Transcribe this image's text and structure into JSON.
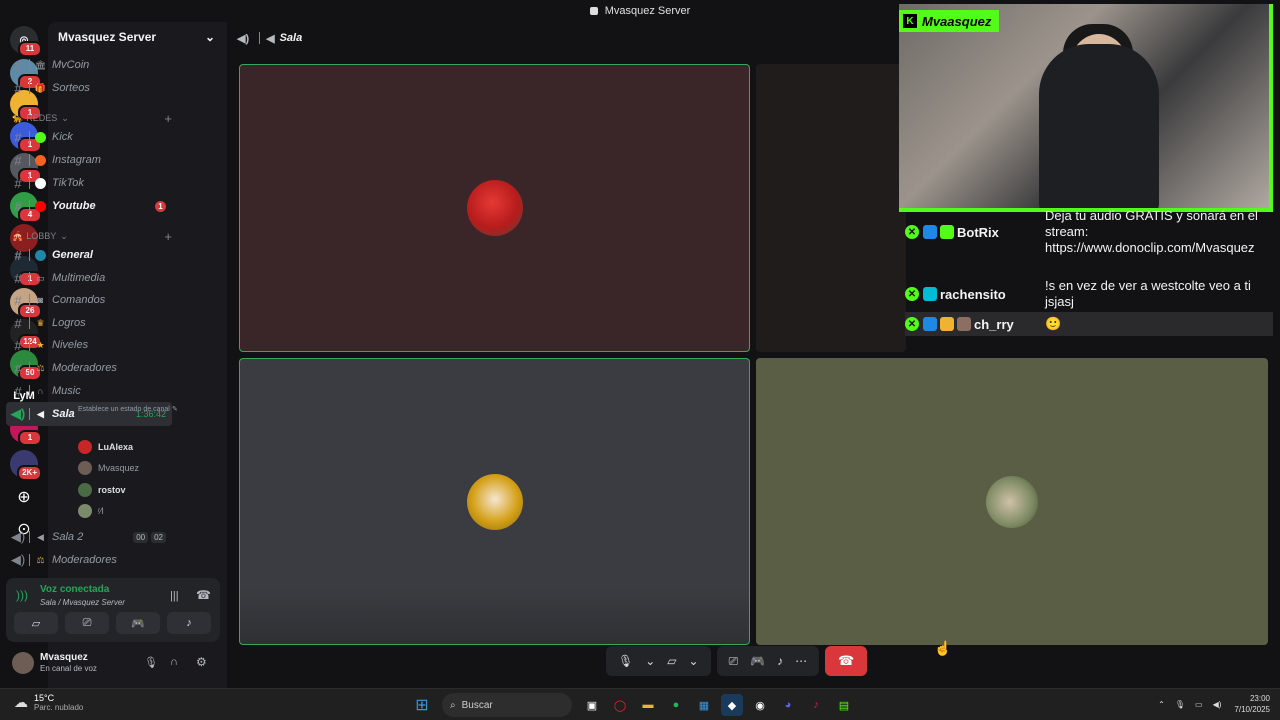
{
  "window": {
    "title": "Mvasquez Server"
  },
  "server_rail": {
    "badges": [
      "11",
      "2",
      "1",
      "1",
      "1",
      "1",
      "4",
      "1",
      "1",
      "26",
      "124",
      "50",
      "1",
      "2K+"
    ],
    "text_server": "LyM"
  },
  "sidebar": {
    "server_name": "Mvasquez Server",
    "channels_top": [
      {
        "label": "MvCoin",
        "icon": "bank-icon"
      },
      {
        "label": "Sorteos",
        "icon": "gift-icon"
      }
    ],
    "category_redes": "REDES",
    "channels_redes": [
      {
        "label": "Kick",
        "color": "#53fc18"
      },
      {
        "label": "Instagram",
        "color": "#f26322"
      },
      {
        "label": "TikTok",
        "color": "#ffffff"
      },
      {
        "label": "Youtube",
        "color": "#ff0000",
        "badge": "1"
      }
    ],
    "category_lobby": "LOBBY",
    "channels_lobby": [
      {
        "label": "General",
        "icon": "globe-icon"
      },
      {
        "label": "Multimedia",
        "icon": "image-icon"
      },
      {
        "label": "Comandos",
        "icon": "robot-icon"
      },
      {
        "label": "Logros",
        "icon": "trophy-icon"
      },
      {
        "label": "Niveles",
        "icon": "star-icon"
      },
      {
        "label": "Moderadores",
        "icon": "scale-icon"
      },
      {
        "label": "Music",
        "icon": "headphones-icon"
      }
    ],
    "active_voice": {
      "label": "Sala",
      "time": "1:36:42",
      "status": "Establece un estado de canal"
    },
    "voice_users": [
      "LuAlexa",
      "Mvasquez",
      "rostov",
      "ʳ⁄l"
    ],
    "voice_channels": [
      {
        "label": "Sala 2",
        "count_a": "00",
        "count_b": "02"
      },
      {
        "label": "Moderadores"
      }
    ]
  },
  "voice_panel": {
    "connected": "Voz conectada",
    "location": "Sala / Mvasquez Server"
  },
  "user": {
    "name": "Mvasquez",
    "status": "En canal de voz"
  },
  "main": {
    "channel_name": "Sala"
  },
  "stream_overlay": {
    "streamer": "Mvaasquez",
    "messages": [
      {
        "user": "BotRix",
        "text": "Deja tu audio GRATIS y sonará en el stream: https://www.donoclip.com/Mvasquez"
      },
      {
        "user": "rachensito",
        "text": "!s en vez de ver a westcolte veo a ti jsjasj"
      },
      {
        "user": "ch_rry",
        "text": "🙂"
      }
    ]
  },
  "taskbar": {
    "weather_temp": "15°C",
    "weather_desc": "Parc. nublado",
    "search_placeholder": "Buscar",
    "time": "23:00",
    "date": "7/10/2025"
  },
  "colors": {
    "accent_green": "#23a55a",
    "kick_green": "#53fc18",
    "danger": "#da373c"
  }
}
